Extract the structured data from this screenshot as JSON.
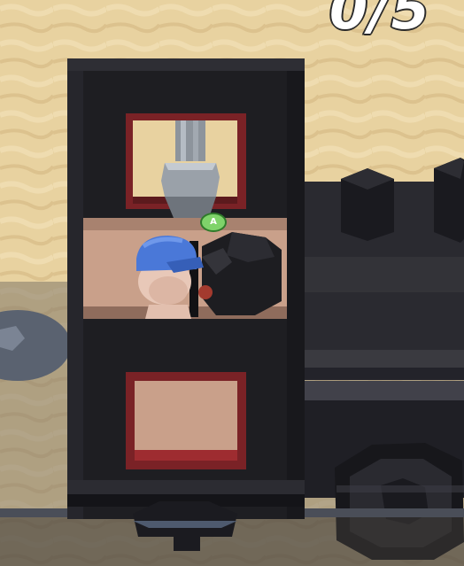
{
  "hud": {
    "counter": "0/5"
  },
  "locomotive": {
    "badge_label": "A"
  },
  "colors": {
    "sand": "#e8d2a0",
    "cab_black": "#1e1e22",
    "window_frame_red": "#7a2226",
    "cab_interior": "#c9a08a",
    "cap_blue": "#4a78d8",
    "skin": "#e8c8b8",
    "badge_green": "#7fd36a"
  }
}
